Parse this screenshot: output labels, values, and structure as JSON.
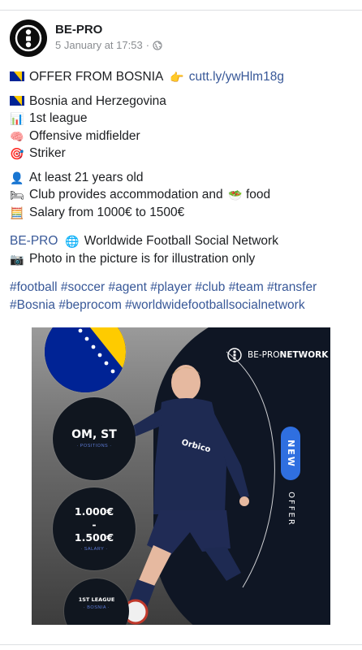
{
  "post": {
    "page_name": "BE-PRO",
    "timestamp": "5 January at 17:53",
    "separator": "·",
    "audience_icon": "globe-icon"
  },
  "content": {
    "offer_text": "OFFER FROM BOSNIA",
    "offer_link": "cutt.ly/ywHlm18g",
    "country": "Bosnia and Herzegovina",
    "league": "1st league",
    "position_1": "Offensive midfielder",
    "position_2": "Striker",
    "age": "At least 21 years old",
    "accommodation_text": "Club provides accommodation and",
    "food_text": "food",
    "salary": "Salary from 1000€ to 1500€",
    "brand_link": "BE-PRO",
    "tagline": "Worldwide Football Social Network",
    "photo_note": "Photo in the picture is for illustration only",
    "hashtags_line1": "#football #soccer #agent #player #club #team #transfer",
    "hashtags_line2": "#Bosnia #beprocom #worldwidefootballsocialnetwork"
  },
  "icons": {
    "flag": "bosnia-flag-icon",
    "pointing": "pointing-right-icon",
    "chart": "bar-chart-icon",
    "brain": "brain-icon",
    "target": "target-icon",
    "person": "person-silhouette-icon",
    "bed": "bed-icon",
    "salad": "salad-icon",
    "abacus": "abacus-icon",
    "globe": "globe-icon",
    "camera": "camera-icon"
  },
  "promo": {
    "logo_light": "BE-PRO",
    "logo_bold": "NETWORK",
    "positions_value": "OM, ST",
    "positions_label": "· POSITIONS ·",
    "salary_from": "1.000€",
    "salary_dash": "-",
    "salary_to": "1.500€",
    "salary_label": "· SALARY ·",
    "league_value": "1ST LEAGUE",
    "league_label": "· BOSNIA ·",
    "new_badge": "NEW",
    "offer_label": "OFFER"
  },
  "colors": {
    "link": "#385898",
    "promo_bg": "#141a2b",
    "badge_blue": "#2f6fe0",
    "flag_blue": "#002395",
    "flag_yellow": "#FECB00"
  }
}
